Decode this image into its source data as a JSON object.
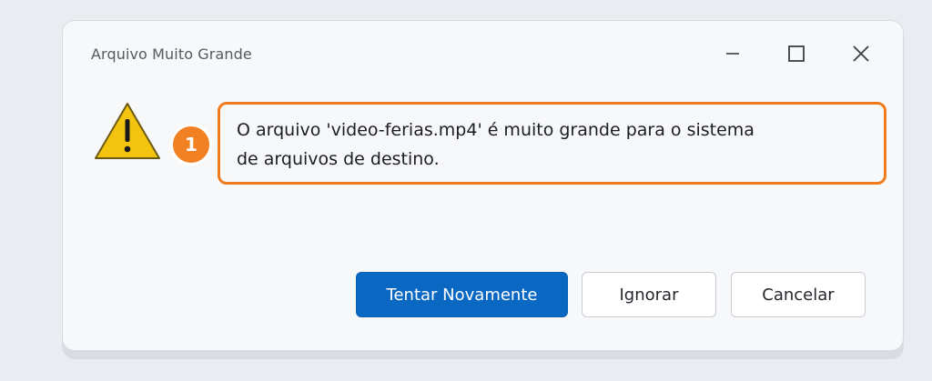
{
  "window": {
    "title": "Arquivo Muito Grande",
    "controls": {
      "minimize_icon": "minimize-icon",
      "maximize_icon": "maximize-icon",
      "close_icon": "close-icon"
    }
  },
  "message": {
    "icon": "warning-icon",
    "annotation_number": "1",
    "line1": "O arquivo 'video-ferias.mp4' é muito grande para o sistema",
    "line2": "de arquivos de destino."
  },
  "buttons": {
    "retry": "Tentar Novamente",
    "ignore": "Ignorar",
    "cancel": "Cancelar"
  },
  "colors": {
    "primary": "#0a67c2",
    "highlight": "#f07b1d",
    "warning_fill": "#f2c40f"
  }
}
